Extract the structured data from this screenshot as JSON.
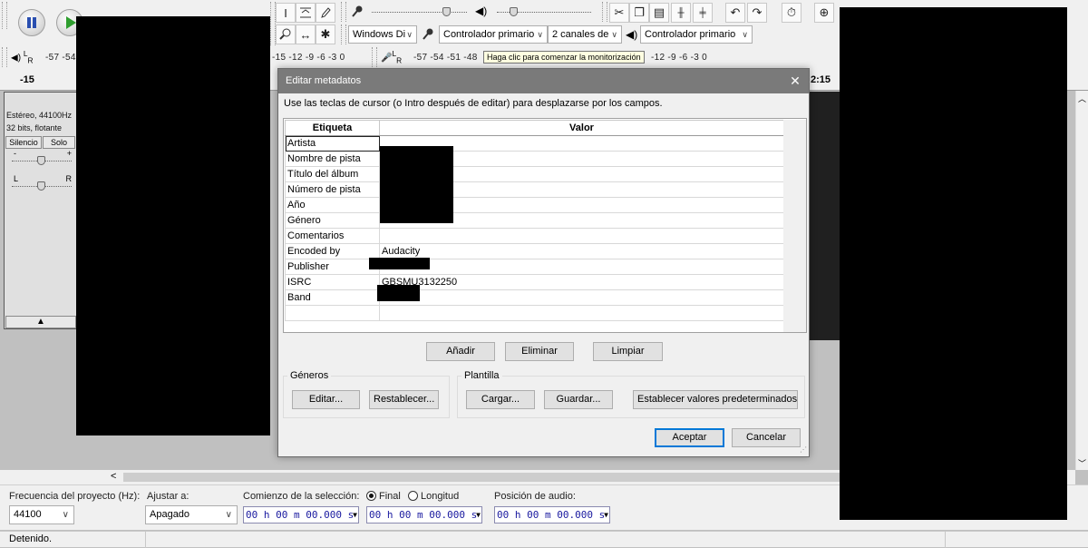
{
  "toolbar": {
    "host_select": "Windows Di",
    "recording_device": "Controlador primario",
    "channels": "2 canales de",
    "playback_device": "Controlador primario",
    "meter_play_scale": "-57 -54",
    "meter_rec_scale_left": "-15 -12 -9 -6 -3 0",
    "meter_rec_scale": "-57 -54 -51 -48",
    "meter_rec_scale_right": "-12 -9 -6 -3 0",
    "monitor_tooltip": "Haga clic para comenzar la monitorización"
  },
  "ruler": {
    "left_value": "-15",
    "right_value": "2:15"
  },
  "track": {
    "info_line1": "Estéreo, 44100Hz",
    "info_line2": "32 bits, flotante",
    "mute_label": "Silencio",
    "solo_label": "Solo",
    "gain_minus": "-",
    "gain_plus": "+",
    "pan_left": "L",
    "pan_right": "R"
  },
  "dialog": {
    "title": "Editar metadatos",
    "close_glyph": "✕",
    "instructions": "Use las teclas de cursor (o Intro después de editar) para desplazarse por los campos.",
    "col_tag": "Etiqueta",
    "col_value": "Valor",
    "rows": [
      {
        "tag": "Artista",
        "value": ""
      },
      {
        "tag": "Nombre de pista",
        "value": ""
      },
      {
        "tag": "Título del álbum",
        "value": ""
      },
      {
        "tag": "Número de pista",
        "value": ""
      },
      {
        "tag": "Año",
        "value": ""
      },
      {
        "tag": "Género",
        "value": ""
      },
      {
        "tag": "Comentarios",
        "value": ""
      },
      {
        "tag": "Encoded by",
        "value": "Audacity"
      },
      {
        "tag": "Publisher",
        "value": ""
      },
      {
        "tag": "ISRC",
        "value": "GBSMU3132250"
      },
      {
        "tag": "Band",
        "value": ""
      },
      {
        "tag": "",
        "value": ""
      }
    ],
    "add_label": "Añadir",
    "delete_label": "Eliminar",
    "clear_label": "Limpiar",
    "genres_group": "Géneros",
    "edit_label": "Editar...",
    "reset_label": "Restablecer...",
    "template_group": "Plantilla",
    "load_label": "Cargar...",
    "save_label": "Guardar...",
    "set_defaults_label": "Establecer valores predeterminados",
    "ok_label": "Aceptar",
    "cancel_label": "Cancelar"
  },
  "selection_bar": {
    "rate_label": "Frecuencia del proyecto (Hz):",
    "rate_value": "44100",
    "snap_label": "Ajustar a:",
    "snap_value": "Apagado",
    "start_label": "Comienzo de la selección:",
    "end_option": "Final",
    "length_option": "Longitud",
    "start_time": "00 h 00 m 00.000 s",
    "end_time": "00 h 00 m 00.000 s",
    "audio_pos_label": "Posición de audio:",
    "audio_pos_time": "00 h 00 m 00.000 s"
  },
  "status": {
    "text": "Detenido."
  },
  "colors": {
    "dialog_title_bg": "#7a7a7a",
    "default_button_border": "#0078d7",
    "time_digits": "#1a1aa0",
    "redaction": "#000000"
  },
  "icons": [
    "pause-icon",
    "play-icon",
    "ibeam-tool-icon",
    "envelope-tool-icon",
    "pencil-tool-icon",
    "zoom-tool-icon",
    "timeshift-tool-icon",
    "multi-tool-icon",
    "microphone-icon",
    "speaker-icon",
    "cut-icon",
    "copy-icon",
    "paste-icon",
    "trim-icon",
    "silence-icon",
    "undo-icon",
    "redo-icon",
    "timer-icon",
    "zoom-in-icon"
  ]
}
